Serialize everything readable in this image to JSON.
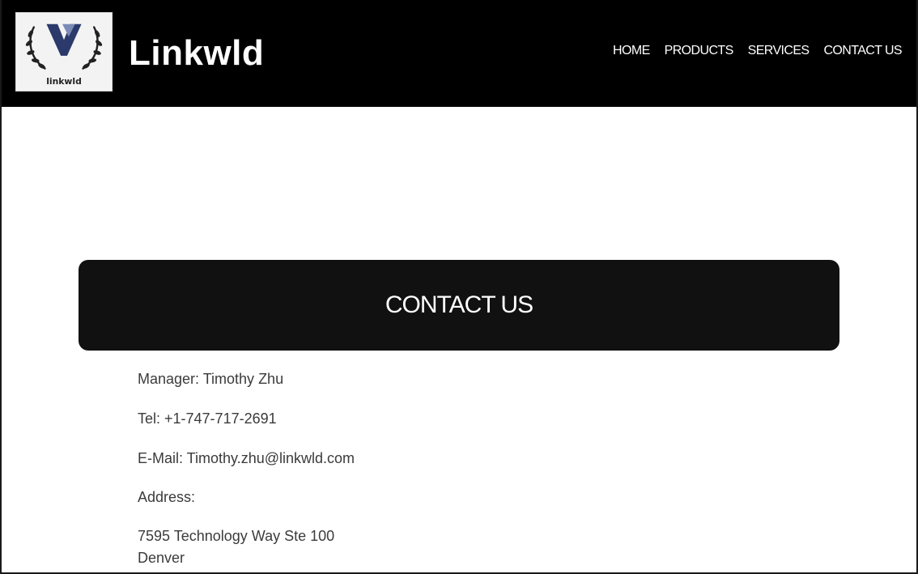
{
  "header": {
    "brand": "Linkwld",
    "logo_text": "linkwld",
    "nav": [
      "HOME",
      "PRODUCTS",
      "SERVICES",
      "CONTACT US"
    ]
  },
  "banner": {
    "title": "CONTACT US"
  },
  "contact": {
    "manager": "Manager: Timothy Zhu",
    "tel": "Tel: +1-747-717-2691",
    "email": "E-Mail: Timothy.zhu@linkwld.com",
    "address_label": "Address:",
    "address_line1": "7595 Technology Way Ste 100",
    "address_line2": "Denver"
  },
  "colors": {
    "header_bg": "#000000",
    "banner_bg": "#111111",
    "text": "#3b3b3b"
  }
}
